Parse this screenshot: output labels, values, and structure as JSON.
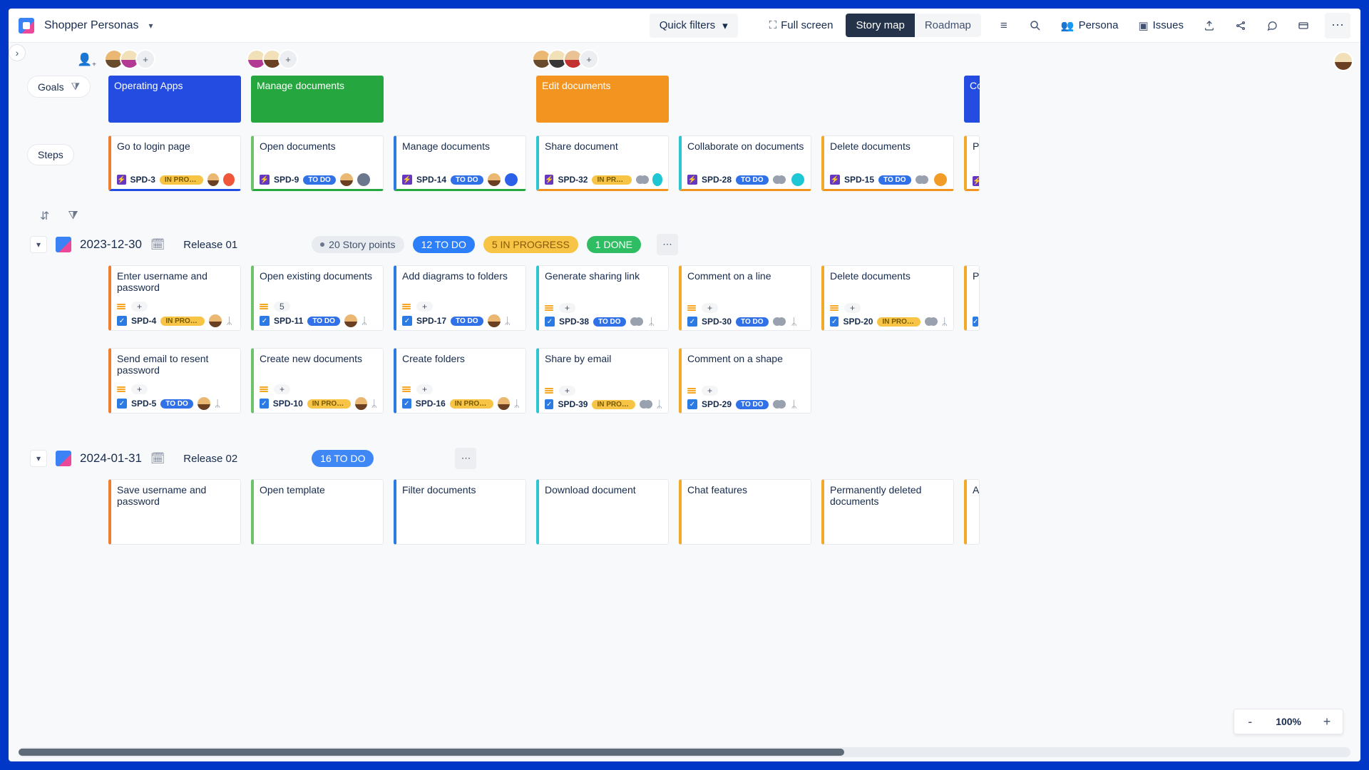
{
  "header": {
    "project_name": "Shopper Personas",
    "quick_filters": "Quick filters",
    "full_screen": "Full screen",
    "view_story_map": "Story map",
    "view_roadmap": "Roadmap",
    "persona": "Persona",
    "issues": "Issues"
  },
  "lane_labels": {
    "goals": "Goals",
    "steps": "Steps"
  },
  "goals": [
    {
      "title": "Operating Apps",
      "color": "blue"
    },
    {
      "title": "Manage documents",
      "color": "green"
    },
    {
      "title": "Edit documents",
      "color": "orange"
    },
    {
      "title": "Cor",
      "color": "partial"
    }
  ],
  "step_cards": [
    {
      "title": "Go to login page",
      "key": "SPD-3",
      "status_text": "IN PROG…",
      "status": "prog",
      "left": "#ed7f33",
      "bottom": "#244ce0",
      "dot": "a2",
      "single_av": true
    },
    {
      "title": "Open documents",
      "key": "SPD-9",
      "status_text": "TO DO",
      "status": "todo",
      "left": "#6dc26a",
      "bottom": "#26a63e",
      "dot": "a3",
      "single_av": true
    },
    {
      "title": "Manage documents",
      "key": "SPD-14",
      "status_text": "TO DO",
      "status": "todo",
      "left": "#2c7be5",
      "bottom": "#26a63e",
      "dot": "a5",
      "single_av": true
    },
    {
      "title": "Share document",
      "key": "SPD-32",
      "status_text": "IN PROG…",
      "status": "prog",
      "left": "#2dc5cf",
      "bottom": "#f39421",
      "dot": "a4",
      "dbl_av": true
    },
    {
      "title": "Collaborate on documents",
      "key": "SPD-28",
      "status_text": "TO DO",
      "status": "todo",
      "left": "#2dc5cf",
      "bottom": "#f39421",
      "dot": "a4",
      "dbl_av": true
    },
    {
      "title": "Delete documents",
      "key": "SPD-15",
      "status_text": "TO DO",
      "status": "todo",
      "left": "#f0a928",
      "bottom": "#f39421",
      "dot": "a6",
      "dbl_av": true
    },
    {
      "title": "Pre",
      "key": "S",
      "status_text": "",
      "status": "todo",
      "left": "#f0a928",
      "bottom": "#f39421",
      "partial": true
    }
  ],
  "release1": {
    "date": "2023-12-30",
    "name": "Release 01",
    "story_points": "20 Story points",
    "todo": "12 TO DO",
    "inprog": "5 IN PROGRESS",
    "done": "1 DONE",
    "stories_row1": [
      {
        "title": "Enter username and password",
        "key": "SPD-4",
        "status_text": "IN PROG…",
        "status": "prog",
        "left": "#ed7f33",
        "plus": "+",
        "single_av": true
      },
      {
        "title": "Open existing documents",
        "key": "SPD-11",
        "status_text": "TO DO",
        "status": "todo",
        "left": "#6dc26a",
        "plus": "5",
        "single_av": true
      },
      {
        "title": "Add diagrams to folders",
        "key": "SPD-17",
        "status_text": "TO DO",
        "status": "todo",
        "left": "#2c7be5",
        "plus": "+",
        "single_av": true
      },
      {
        "title": "Generate sharing link",
        "key": "SPD-38",
        "status_text": "TO DO",
        "status": "todo",
        "left": "#2dc5cf",
        "plus": "+",
        "dbl_av": true
      },
      {
        "title": "Comment on a line",
        "key": "SPD-30",
        "status_text": "TO DO",
        "status": "todo",
        "left": "#f0a928",
        "plus": "+",
        "dbl_av": true
      },
      {
        "title": "Delete documents",
        "key": "SPD-20",
        "status_text": "IN PROG…",
        "status": "prog",
        "left": "#f0a928",
        "plus": "+",
        "dbl_av": true
      },
      {
        "title": "P",
        "key": "",
        "status_text": "",
        "status": "todo",
        "left": "#f0a928",
        "partial": true
      }
    ],
    "stories_row2": [
      {
        "title": "Send email to resent password",
        "key": "SPD-5",
        "status_text": "TO DO",
        "status": "todo",
        "left": "#ed7f33",
        "plus": "+",
        "single_av": true
      },
      {
        "title": "Create new documents",
        "key": "SPD-10",
        "status_text": "IN PROG…",
        "status": "prog",
        "left": "#6dc26a",
        "plus": "+",
        "single_av": true
      },
      {
        "title": "Create folders",
        "key": "SPD-16",
        "status_text": "IN PROG…",
        "status": "prog",
        "left": "#2c7be5",
        "plus": "+",
        "single_av": true
      },
      {
        "title": "Share by email",
        "key": "SPD-39",
        "status_text": "IN PROG…",
        "status": "prog",
        "left": "#2dc5cf",
        "plus": "+",
        "dbl_av": true
      },
      {
        "title": "Comment on a shape",
        "key": "SPD-29",
        "status_text": "TO DO",
        "status": "todo",
        "left": "#f0a928",
        "plus": "+",
        "dbl_av": true
      }
    ]
  },
  "release2": {
    "date": "2024-01-31",
    "name": "Release 02",
    "todo": "16 TO DO",
    "stories_row1": [
      {
        "title": "Save username and password",
        "left": "#ed7f33"
      },
      {
        "title": "Open template",
        "left": "#6dc26a"
      },
      {
        "title": "Filter documents",
        "left": "#2c7be5"
      },
      {
        "title": "Download document",
        "left": "#2dc5cf"
      },
      {
        "title": "Chat features",
        "left": "#f0a928"
      },
      {
        "title": "Permanently deleted documents",
        "left": "#f0a928"
      },
      {
        "title": "A",
        "left": "#f0a928",
        "partial": true
      }
    ]
  },
  "zoom": {
    "value": "100%"
  }
}
